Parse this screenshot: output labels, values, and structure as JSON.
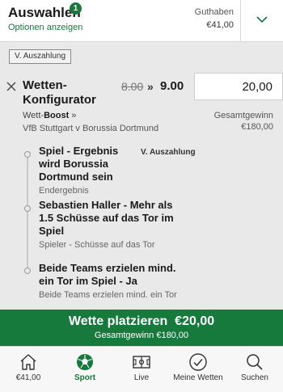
{
  "header": {
    "title": "Auswahlen",
    "badge_count": "1",
    "options_link": "Optionen anzeigen",
    "balance_label": "Guthaben",
    "balance_value": "€41,00"
  },
  "cashout_button": "V. Auszahlung",
  "bet": {
    "title": "Wetten-Konfigurator",
    "odds_old": "8.00",
    "odds_arrow": "»",
    "odds_new": "9.00",
    "stake": "20,00",
    "type_prefix": "Wett-",
    "type_bold": "Boost",
    "type_suffix": " »",
    "event": "VfB Stuttgart v Borussia Dortmund",
    "total_label": "Gesamtgewinn",
    "total_value": "€180,00",
    "cashout_small": "V. Auszahlung",
    "legs": [
      {
        "title": "Spiel - Ergebnis wird Borussia Dortmund sein",
        "market": "Endergebnis"
      },
      {
        "title": "Sebastien Haller - Mehr als 1.5 Schüsse auf das Tor im Spiel",
        "market": "Spieler - Schüsse auf das Tor"
      },
      {
        "title": "Beide Teams erzielen mind. ein Tor im Spiel - Ja",
        "market": "Beide Teams erzielen mind. ein Tor"
      }
    ]
  },
  "place_bet": {
    "label": "Wette platzieren",
    "amount": "€20,00",
    "total_text": "Gesamtgewinn €180,00"
  },
  "nav": [
    {
      "label": "€41,00",
      "icon": "home-icon"
    },
    {
      "label": "Sport",
      "icon": "football-icon",
      "active": true
    },
    {
      "label": "Live",
      "icon": "pitch-icon"
    },
    {
      "label": "Meine Wetten",
      "icon": "check-circle-icon"
    },
    {
      "label": "Suchen",
      "icon": "search-icon"
    }
  ],
  "colors": {
    "brand_green": "#157a3c",
    "background": "#e9e9e9"
  }
}
